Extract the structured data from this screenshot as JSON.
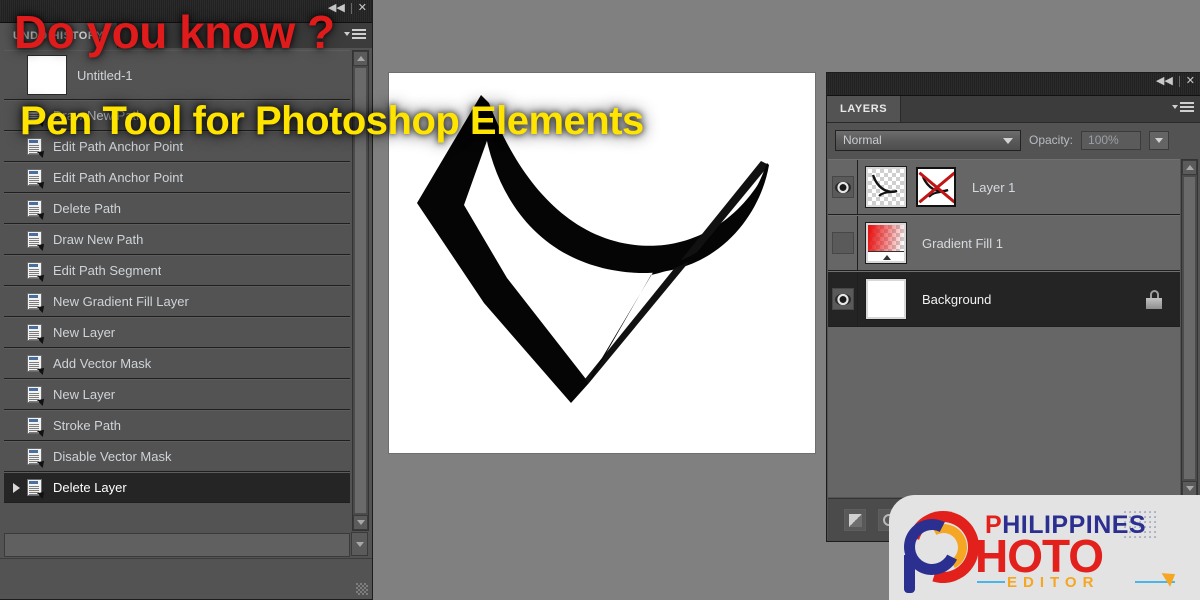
{
  "app": {
    "window_controls": {
      "collapse": "◀◀",
      "close": "✕"
    }
  },
  "history_panel": {
    "tab_label": "UNDO HISTORY",
    "snapshot": {
      "name": "Untitled-1"
    },
    "items": [
      {
        "label": "Draw New Path",
        "selected": false
      },
      {
        "label": "Edit Path Anchor Point",
        "selected": false
      },
      {
        "label": "Edit Path Anchor Point",
        "selected": false
      },
      {
        "label": "Delete Path",
        "selected": false
      },
      {
        "label": "Draw New Path",
        "selected": false
      },
      {
        "label": "Edit Path Segment",
        "selected": false
      },
      {
        "label": "New Gradient Fill Layer",
        "selected": false
      },
      {
        "label": "New Layer",
        "selected": false
      },
      {
        "label": "Add Vector Mask",
        "selected": false
      },
      {
        "label": "New Layer",
        "selected": false
      },
      {
        "label": "Stroke Path",
        "selected": false
      },
      {
        "label": "Disable Vector Mask",
        "selected": false
      },
      {
        "label": "Delete Layer",
        "selected": true
      }
    ]
  },
  "layers_panel": {
    "tab_label": "LAYERS",
    "blend_mode": "Normal",
    "opacity_label": "Opacity:",
    "opacity_value": "100%",
    "layers": [
      {
        "name": "Layer 1",
        "visible": true,
        "selected": false,
        "locked": false,
        "thumb": "transparent-curve",
        "mask": "disabled-vector-mask"
      },
      {
        "name": "Gradient Fill 1",
        "visible": false,
        "selected": false,
        "locked": false,
        "thumb": "red-gradient",
        "mask": "none"
      },
      {
        "name": "Background",
        "visible": true,
        "selected": true,
        "locked": true,
        "thumb": "white",
        "mask": "none"
      }
    ],
    "footer_buttons": [
      "new-layer-button",
      "new-adjustment-layer-button"
    ]
  },
  "overlays": {
    "headline_red": "Do you know ?",
    "headline_yellow": "Pen Tool for Photoshop Elements"
  },
  "watermark": {
    "brand_top": "PHILIPPINES",
    "brand_top_p": "P",
    "brand_top_rest": "HILIPPINES",
    "brand_main": "HOTO",
    "brand_sub": "EDITOR"
  },
  "colors": {
    "red_headline": "#e01b1b",
    "yellow_headline": "#ffe400",
    "panel_bg": "#535353",
    "brand_blue": "#2b2f90",
    "brand_red": "#e2201c",
    "brand_orange": "#f5a623"
  }
}
